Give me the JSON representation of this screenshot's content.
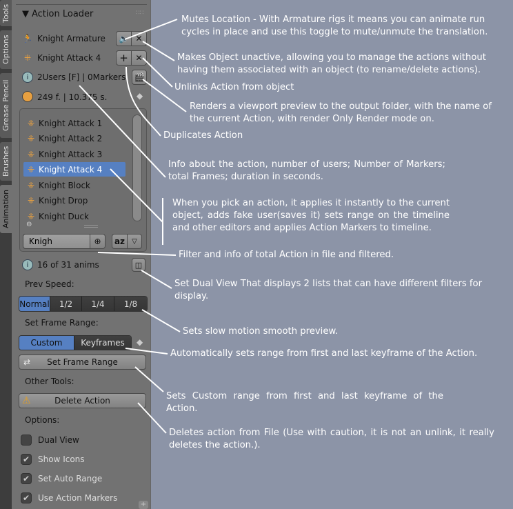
{
  "tabs": [
    "Tools",
    "Options",
    "Grease Pencil",
    "Brushes",
    "Animation"
  ],
  "panel": {
    "title": "Action Loader",
    "object_name": "Knight Armature",
    "action_name": "Knight Attack 4",
    "info": "2Users  [F] | 0Markers",
    "frames": "249 f. | 10.375 s.",
    "actions": [
      "Knight Attack 1",
      "Knight Attack 2",
      "Knight Attack 3",
      "Knight Attack 4",
      "Knight Block",
      "Knight Drop",
      "Knight Duck"
    ],
    "selected_action": "Knight Attack 4",
    "filter_value": "Knigh",
    "sort_label": "az",
    "count": "16 of 31 anims",
    "prev_speed_label": "Prev Speed:",
    "speeds": [
      "Normal",
      "1/2",
      "1/4",
      "1/8"
    ],
    "speed_selected": "Normal",
    "frame_range_label": "Set Frame Range:",
    "range_modes": [
      "Custom",
      "Keyframes"
    ],
    "range_selected": "Custom",
    "set_frame_range": "Set Frame Range",
    "other_tools_label": "Other Tools:",
    "delete_action": "Delete Action",
    "options_label": "Options:",
    "options": [
      {
        "label": "Dual View",
        "checked": false
      },
      {
        "label": "Show Icons",
        "checked": true
      },
      {
        "label": "Set Auto Range",
        "checked": true
      },
      {
        "label": "Use Action Markers",
        "checked": true
      }
    ]
  },
  "notes": [
    "Mutes Location - With Armature rigs it means you can animate run cycles in place and use this toggle to mute/unmute the translation.",
    "Makes Object unactive, allowing you to manage the actions without having them associated with an object (to rename/delete actions).",
    "Unlinks Action from object",
    "Renders a viewport preview to the output folder, with the name of the current Action, with render Only Render mode on.",
    "Duplicates Action",
    "Info about the action, number of users; Number of Markers; total Frames; duration in seconds.",
    "When you pick an action, it applies it instantly to the current object, adds fake user(saves it) sets range on the timeline and other editors and applies Action Markers to timeline.",
    "Filter and info of total Action in file and filtered.",
    "Set Dual View That displays 2 lists that can have different filters for display.",
    "Sets slow motion smooth preview.",
    "Automatically sets range from first and last keyframe of the Action.",
    "Sets Custom range from first and last keyframe of the Action.",
    "Deletes action from File (Use with caution, it is not an unlink, it really deletes the action.)."
  ],
  "colors": {
    "accent": "#5680c2",
    "background": "#8c94a7",
    "panel": "#727272"
  }
}
